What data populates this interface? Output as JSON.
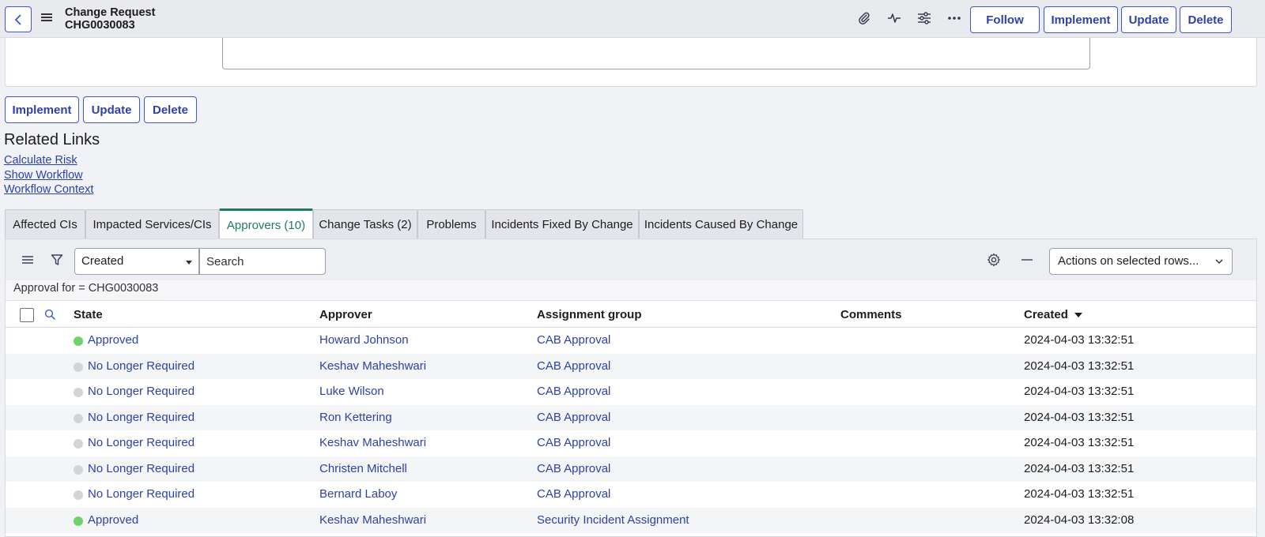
{
  "header": {
    "title": "Change Request",
    "number": "CHG0030083",
    "buttons": {
      "follow": "Follow",
      "implement": "Implement",
      "update": "Update",
      "delete": "Delete"
    }
  },
  "actions": {
    "implement": "Implement",
    "update": "Update",
    "delete": "Delete"
  },
  "related_links": {
    "title": "Related Links",
    "items": [
      "Calculate Risk",
      "Show Workflow",
      "Workflow Context"
    ]
  },
  "tabs": [
    "Affected CIs",
    "Impacted Services/CIs",
    "Approvers (10)",
    "Change Tasks (2)",
    "Problems",
    "Incidents Fixed By Change",
    "Incidents Caused By Change"
  ],
  "active_tab_index": 2,
  "list": {
    "filter_field": "Created",
    "search_placeholder": "Search",
    "actions_placeholder": "Actions on selected rows...",
    "breadcrumb": "Approval for = CHG0030083",
    "columns": {
      "state": "State",
      "approver": "Approver",
      "group": "Assignment group",
      "comments": "Comments",
      "created": "Created"
    },
    "rows": [
      {
        "state": "Approved",
        "approver": "Howard Johnson",
        "group": "CAB Approval",
        "comments": "",
        "created": "2024-04-03 13:32:51"
      },
      {
        "state": "No Longer Required",
        "approver": "Keshav Maheshwari",
        "group": "CAB Approval",
        "comments": "",
        "created": "2024-04-03 13:32:51"
      },
      {
        "state": "No Longer Required",
        "approver": "Luke Wilson",
        "group": "CAB Approval",
        "comments": "",
        "created": "2024-04-03 13:32:51"
      },
      {
        "state": "No Longer Required",
        "approver": "Ron Kettering",
        "group": "CAB Approval",
        "comments": "",
        "created": "2024-04-03 13:32:51"
      },
      {
        "state": "No Longer Required",
        "approver": "Keshav Maheshwari",
        "group": "CAB Approval",
        "comments": "",
        "created": "2024-04-03 13:32:51"
      },
      {
        "state": "No Longer Required",
        "approver": "Christen Mitchell",
        "group": "CAB Approval",
        "comments": "",
        "created": "2024-04-03 13:32:51"
      },
      {
        "state": "No Longer Required",
        "approver": "Bernard Laboy",
        "group": "CAB Approval",
        "comments": "",
        "created": "2024-04-03 13:32:51"
      },
      {
        "state": "Approved",
        "approver": "Keshav Maheshwari",
        "group": "Security Incident Assignment",
        "comments": "",
        "created": "2024-04-03 13:32:08"
      }
    ]
  },
  "colors": {
    "approved": "#6fd36b",
    "no_longer_required": "#d3d4d8",
    "link": "#2c42a8",
    "active_tab": "#1f7a63"
  }
}
